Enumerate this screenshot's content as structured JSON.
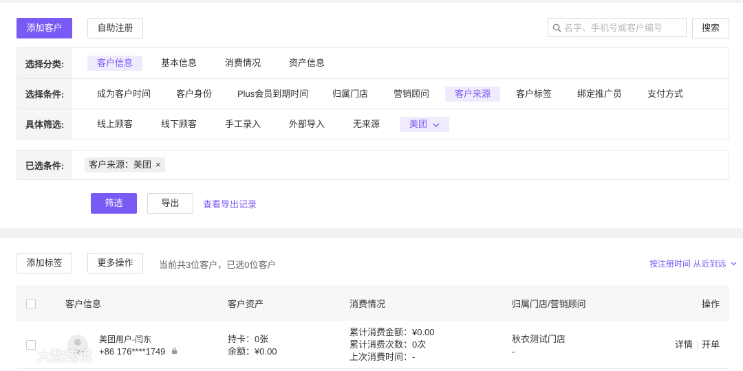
{
  "toolbar": {
    "add_customer": "添加客户",
    "self_register": "自助注册",
    "search_placeholder": "名字、手机号或客户编号",
    "search_button": "搜索"
  },
  "filters": {
    "category": {
      "label": "选择分类:",
      "options": [
        "客户信息",
        "基本信息",
        "消费情况",
        "资产信息"
      ],
      "active_index": 0
    },
    "condition": {
      "label": "选择条件:",
      "options": [
        "成为客户时间",
        "客户身份",
        "Plus会员到期时间",
        "归属门店",
        "营销顾问",
        "客户来源",
        "客户标签",
        "绑定推广员",
        "支付方式"
      ],
      "active_index": 5
    },
    "specific": {
      "label": "具体筛选:",
      "options": [
        "线上顾客",
        "线下顾客",
        "手工录入",
        "外部导入",
        "无来源"
      ],
      "dropdown_value": "美团"
    }
  },
  "selected": {
    "label": "已选条件:",
    "tag": "客户来源：美团",
    "remove": "×"
  },
  "actions": {
    "filter": "筛选",
    "export": "导出",
    "export_history": "查看导出记录"
  },
  "list": {
    "add_tag": "添加标签",
    "more_actions": "更多操作",
    "summary": "当前共3位客户，已选0位客户",
    "sort": "按注册时间 从近到远",
    "columns": {
      "info": "客户信息",
      "assets": "客户资产",
      "consumption": "消费情况",
      "store": "归属门店/营销顾问",
      "ops": "操作"
    },
    "rows": [
      {
        "name": "美团用户-闫东",
        "phone": "+86 176****1749",
        "card": "持卡：0张",
        "balance": "余额：¥0.00",
        "total_amount": "累计消费金额：¥0.00",
        "total_count": "累计消费次数：0次",
        "last_time": "上次消费时间：-",
        "store": "秋衣测试门店",
        "advisor": "-",
        "detail": "详情",
        "open": "开单"
      }
    ]
  },
  "watermark": "大数跨境",
  "colors": {
    "accent": "#7a5af5",
    "accent_light": "#efebfd"
  }
}
